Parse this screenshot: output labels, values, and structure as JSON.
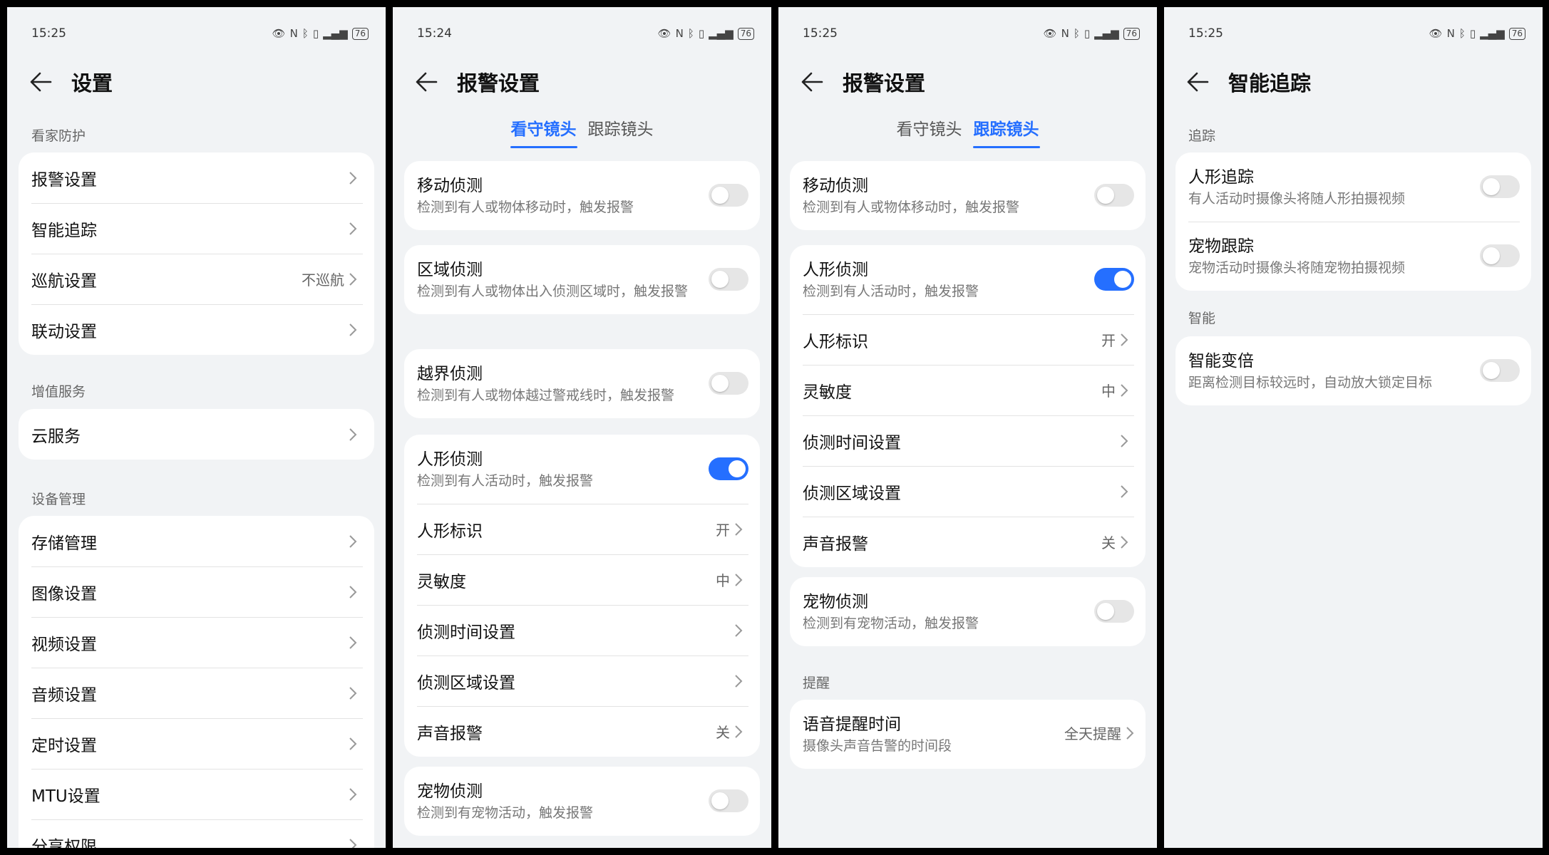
{
  "screens": [
    {
      "time": "15:25",
      "battery": "76",
      "title": "设置",
      "sections": [
        {
          "label": "看家防护",
          "items": [
            {
              "label": "报警设置",
              "value": ""
            },
            {
              "label": "智能追踪",
              "value": ""
            },
            {
              "label": "巡航设置",
              "value": "不巡航"
            },
            {
              "label": "联动设置",
              "value": ""
            }
          ]
        },
        {
          "label": "增值服务",
          "items": [
            {
              "label": "云服务",
              "value": ""
            }
          ]
        },
        {
          "label": "设备管理",
          "items": [
            {
              "label": "存储管理",
              "value": ""
            },
            {
              "label": "图像设置",
              "value": ""
            },
            {
              "label": "视频设置",
              "value": ""
            },
            {
              "label": "音频设置",
              "value": ""
            },
            {
              "label": "定时设置",
              "value": ""
            },
            {
              "label": "MTU设置",
              "value": ""
            },
            {
              "label": "分享权限",
              "value": ""
            }
          ]
        }
      ]
    },
    {
      "time": "15:24",
      "battery": "76",
      "title": "报警设置",
      "tabs": [
        {
          "label": "看守镜头",
          "active": true
        },
        {
          "label": "跟踪镜头",
          "active": false
        }
      ],
      "cards": [
        {
          "rows": [
            {
              "title": "移动侦测",
              "subtitle": "检测到有人或物体移动时，触发报警",
              "toggle": false
            }
          ]
        },
        {
          "rows": [
            {
              "title": "区域侦测",
              "subtitle": "检测到有人或物体出入侦测区域时，触发报警",
              "toggle": false
            }
          ]
        },
        {
          "rows": [
            {
              "title": "越界侦测",
              "subtitle": "检测到有人或物体越过警戒线时，触发报警",
              "toggle": false
            }
          ]
        },
        {
          "rows": [
            {
              "title": "人形侦测",
              "subtitle": "检测到有人活动时，触发报警",
              "toggle": true
            },
            {
              "label": "人形标识",
              "value": "开"
            },
            {
              "label": "灵敏度",
              "value": "中"
            },
            {
              "label": "侦测时间设置",
              "value": ""
            },
            {
              "label": "侦测区域设置",
              "value": ""
            },
            {
              "label": "声音报警",
              "value": "关"
            }
          ]
        },
        {
          "rows": [
            {
              "title": "宠物侦测",
              "subtitle": "检测到有宠物活动，触发报警",
              "toggle": false
            }
          ]
        }
      ]
    },
    {
      "time": "15:25",
      "battery": "76",
      "title": "报警设置",
      "tabs": [
        {
          "label": "看守镜头",
          "active": false
        },
        {
          "label": "跟踪镜头",
          "active": true
        }
      ],
      "cards": [
        {
          "rows": [
            {
              "title": "移动侦测",
              "subtitle": "检测到有人或物体移动时，触发报警",
              "toggle": false
            }
          ]
        },
        {
          "rows": [
            {
              "title": "人形侦测",
              "subtitle": "检测到有人活动时，触发报警",
              "toggle": true
            },
            {
              "label": "人形标识",
              "value": "开"
            },
            {
              "label": "灵敏度",
              "value": "中"
            },
            {
              "label": "侦测时间设置",
              "value": ""
            },
            {
              "label": "侦测区域设置",
              "value": ""
            },
            {
              "label": "声音报警",
              "value": "关"
            }
          ]
        },
        {
          "rows": [
            {
              "title": "宠物侦测",
              "subtitle": "检测到有宠物活动，触发报警",
              "toggle": false
            }
          ]
        }
      ],
      "reminder_label": "提醒",
      "reminder": {
        "title": "语音提醒时间",
        "subtitle": "摄像头声音告警的时间段",
        "value": "全天提醒"
      }
    },
    {
      "time": "15:25",
      "battery": "76",
      "title": "智能追踪",
      "sections": [
        {
          "label": "追踪",
          "rows": [
            {
              "title": "人形追踪",
              "subtitle": "有人活动时摄像头将随人形拍摄视频",
              "toggle": false
            },
            {
              "title": "宠物跟踪",
              "subtitle": "宠物活动时摄像头将随宠物拍摄视频",
              "toggle": false
            }
          ]
        },
        {
          "label": "智能",
          "rows": [
            {
              "title": "智能变倍",
              "subtitle": "距离检测目标较远时，自动放大锁定目标",
              "toggle": false
            }
          ]
        }
      ]
    }
  ],
  "colors": {
    "accent": "#256fff",
    "background": "#f1f3f5",
    "card": "#ffffff"
  }
}
